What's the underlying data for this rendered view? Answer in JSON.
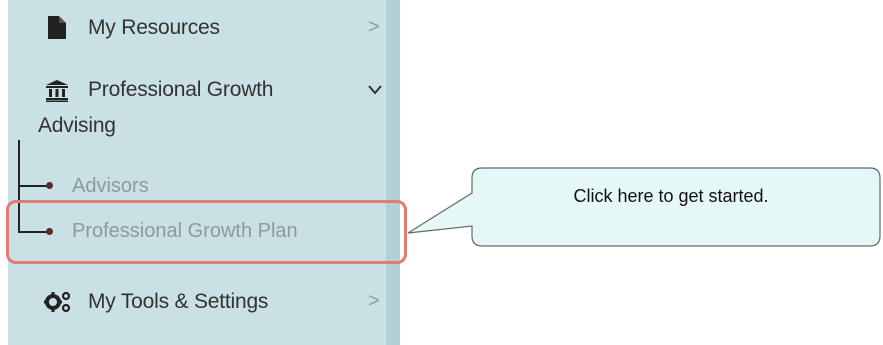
{
  "sidebar": {
    "my_resources": {
      "label": "My Resources",
      "icon": "document-icon",
      "chevron": ">"
    },
    "professional_growth": {
      "label_line1": "Professional Growth",
      "label_line2": "Advising",
      "icon": "bank-icon",
      "chevron": "⌄",
      "children": [
        {
          "label": "Advisors"
        },
        {
          "label": "Professional Growth Plan"
        }
      ]
    },
    "my_tools": {
      "label": "My Tools & Settings",
      "icon": "gears-icon",
      "chevron": ">"
    }
  },
  "callout": {
    "text": "Click here to get started."
  },
  "colors": {
    "sidebar_bg": "#c9e0e4",
    "highlight": "#e07b76",
    "callout_bg": "#e6f7f8"
  }
}
